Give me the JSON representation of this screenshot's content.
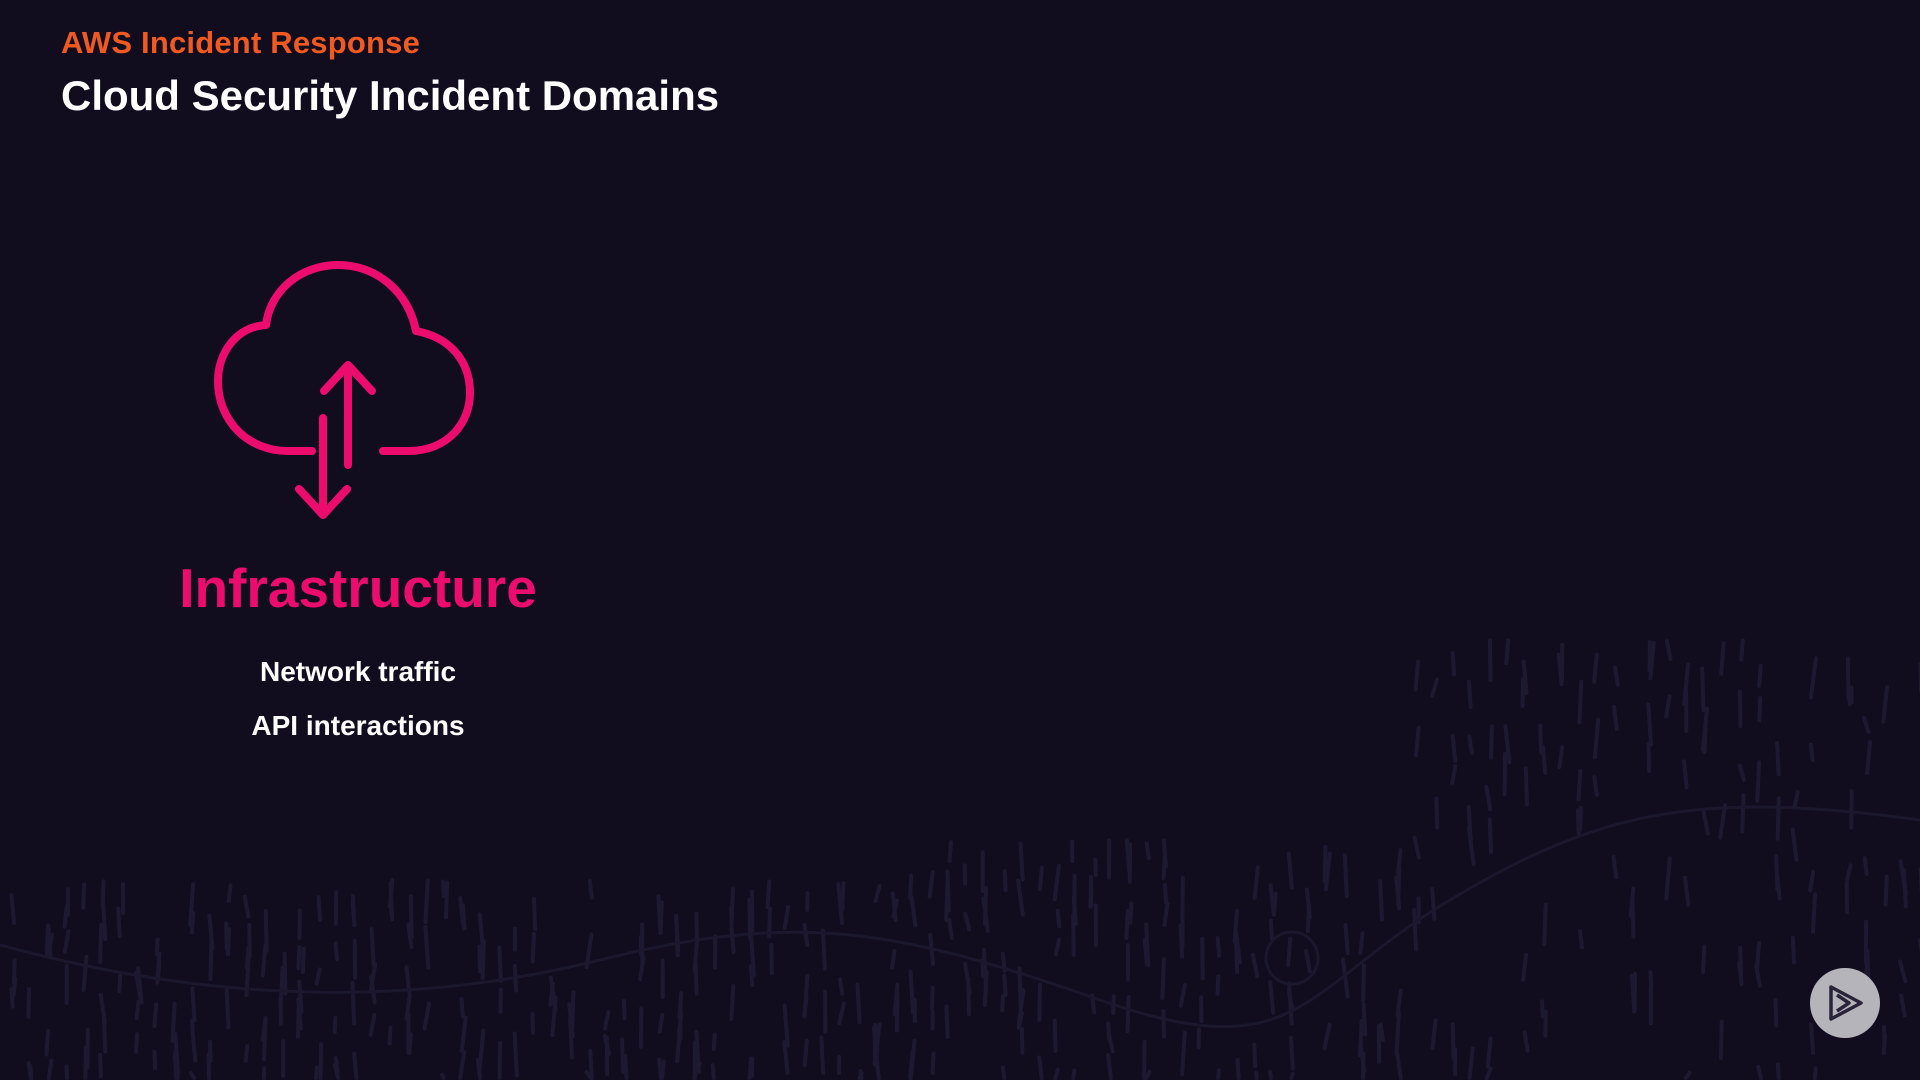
{
  "header": {
    "course_title": "AWS Incident Response",
    "slide_title": "Cloud Security Incident Domains"
  },
  "domain": {
    "icon": "cloud-upload-download-icon",
    "title": "Infrastructure",
    "items": [
      "Network traffic",
      "API interactions"
    ]
  },
  "player": {
    "button_icon": "play-icon"
  },
  "colors": {
    "background": "#110d1f",
    "accent_orange": "#f05a22",
    "accent_pink": "#ec0c6e",
    "text": "#ffffff",
    "button": "#b6b4bb"
  }
}
